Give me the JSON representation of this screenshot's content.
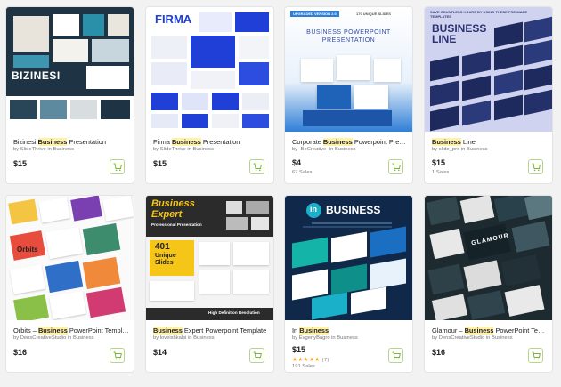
{
  "products": [
    {
      "title_pre": "Bizinesi ",
      "title_hl": "Business",
      "title_post": " Presentation",
      "author": "by SlideThrive in Business",
      "price": "$15",
      "extra": "",
      "thumb_text": "BIZINESI"
    },
    {
      "title_pre": "Firma ",
      "title_hl": "Business",
      "title_post": " Presentation",
      "author": "by SlideThrive in Business",
      "price": "$15",
      "extra": "",
      "thumb_text": "FIRMA"
    },
    {
      "title_pre": "Corporate ",
      "title_hl": "Business",
      "title_post": " Powerpoint Presen...",
      "author": "by -BeCreative- in Business",
      "price": "$4",
      "extra": "67 Sales",
      "thumb_text": "BUSINESS POWERPOINT PRESENTATION",
      "thumb_badges": [
        "UPGRADED VERSION 2.0",
        "170 UNIQUE SLIDES"
      ]
    },
    {
      "title_pre": "",
      "title_hl": "Business",
      "title_post": " Line",
      "author": "by slide_pro in Business",
      "price": "$15",
      "extra": "1 Sales",
      "thumb_text": "BUSINESS LINE",
      "thumb_caption": "SAVE COUNTLESS HOURS BY USING THESE PRE-MADE TEMPLATES"
    },
    {
      "title_pre": "Orbits – ",
      "title_hl": "Business",
      "title_post": " PowerPoint Template",
      "author": "by DensCreativeStudio in Business",
      "price": "$16",
      "extra": "",
      "thumb_text": "Orbits"
    },
    {
      "title_pre": "",
      "title_hl": "Business",
      "title_post": " Expert Powerpoint Template",
      "author": "by loveishkalsi in Business",
      "price": "$14",
      "extra": "",
      "thumb_text": "Business Expert",
      "thumb_sub": "Professional Presentation",
      "thumb_count": "401",
      "thumb_count_label": "Unique Slides",
      "thumb_footer": "High Definition Resolution"
    },
    {
      "title_pre": "In ",
      "title_hl": "Business",
      "title_post": "",
      "author": "by EvgenyBagro in Business",
      "price": "$15",
      "extra": "191 Sales",
      "stars": "★★★★★",
      "rating_count": "(7)",
      "thumb_text": "BUSINESS",
      "thumb_logo": "in"
    },
    {
      "title_pre": "Glamour – ",
      "title_hl": "Business",
      "title_post": " PowerPoint Templ...",
      "author": "by DensCreativeStudio in Business",
      "price": "$16",
      "extra": "",
      "thumb_text": "GLAMOUR"
    }
  ],
  "colors": {
    "cart": "#7fb241",
    "highlight": "#fff1a8"
  },
  "icons": {
    "cart": "cart-icon",
    "star": "star-icon"
  }
}
